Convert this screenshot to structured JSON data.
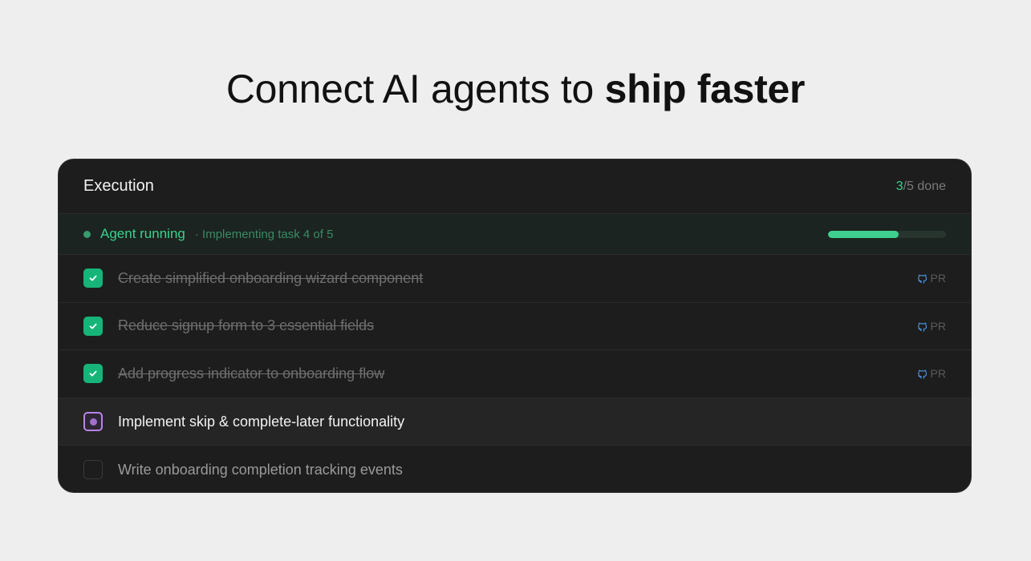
{
  "headline": {
    "regular": "Connect AI agents to ",
    "bold": "ship faster"
  },
  "panel": {
    "title": "Execution",
    "done_count": "3",
    "done_total": "/5 done"
  },
  "status": {
    "label": "Agent running",
    "detail": "· Implementing task 4 of 5",
    "progress": 0.6
  },
  "tasks": [
    {
      "label": "Create simplified onboarding wizard component",
      "state": "done",
      "pr": "PR"
    },
    {
      "label": "Reduce signup form to 3 essential fields",
      "state": "done",
      "pr": "PR"
    },
    {
      "label": "Add progress indicator to onboarding flow",
      "state": "done",
      "pr": "PR"
    },
    {
      "label": "Implement skip & complete-later functionality",
      "state": "current"
    },
    {
      "label": "Write onboarding completion tracking events",
      "state": "todo"
    }
  ],
  "colors": {
    "accent_green": "#3ecf8e",
    "check_green": "#17b47a",
    "active_purple": "#b784e8",
    "github_blue": "#4a8fd8"
  },
  "icons": {
    "check": "check-icon",
    "github": "github-icon"
  }
}
